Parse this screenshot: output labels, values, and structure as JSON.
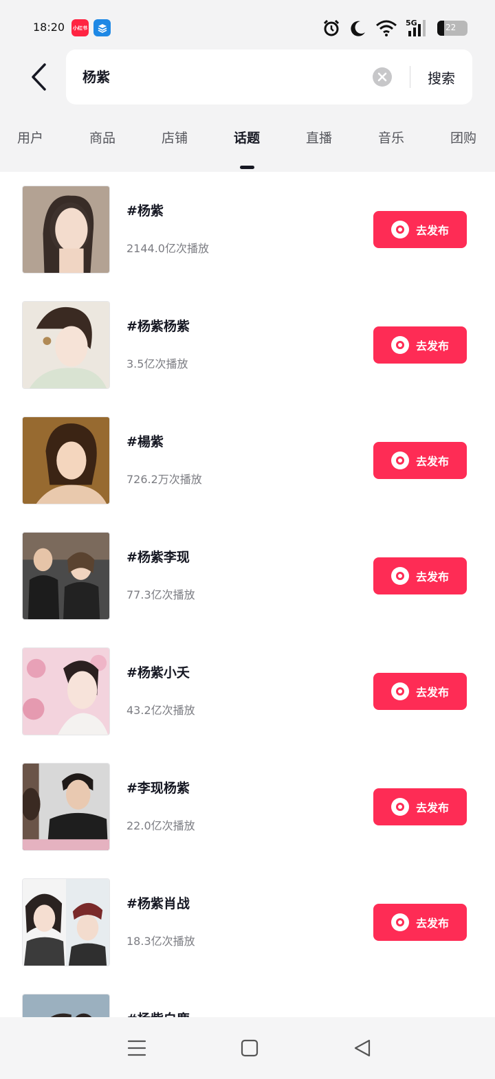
{
  "status_bar": {
    "time": "18:20",
    "apps": [
      {
        "name": "xiaohongshu",
        "label": "小红书",
        "color": "#ff2442"
      },
      {
        "name": "layers-app",
        "label": "",
        "color": "#1e88e5"
      }
    ],
    "icons": [
      "alarm-icon",
      "moon-icon",
      "wifi-icon",
      "signal-5g-icon",
      "battery-icon"
    ],
    "network": "5G",
    "battery": "22",
    "battery_level": 0.22
  },
  "search": {
    "query": "杨紫",
    "button_label": "搜索"
  },
  "tabs": [
    {
      "label": "用户",
      "active": false
    },
    {
      "label": "商品",
      "active": false
    },
    {
      "label": "店铺",
      "active": false
    },
    {
      "label": "话题",
      "active": true
    },
    {
      "label": "直播",
      "active": false
    },
    {
      "label": "音乐",
      "active": false
    },
    {
      "label": "团购",
      "active": false
    }
  ],
  "topics": [
    {
      "title": "#杨紫",
      "views": "2144.0亿次播放",
      "button": "去发布"
    },
    {
      "title": "#杨紫杨紫",
      "views": "3.5亿次播放",
      "button": "去发布"
    },
    {
      "title": "#楊紫",
      "views": "726.2万次播放",
      "button": "去发布"
    },
    {
      "title": "#杨紫李现",
      "views": "77.3亿次播放",
      "button": "去发布"
    },
    {
      "title": "#杨紫小夭",
      "views": "43.2亿次播放",
      "button": "去发布"
    },
    {
      "title": "#李现杨紫",
      "views": "22.0亿次播放",
      "button": "去发布"
    },
    {
      "title": "#杨紫肖战",
      "views": "18.3亿次播放",
      "button": "去发布"
    },
    {
      "title": "#杨紫白鹿",
      "views": "",
      "button": ""
    }
  ],
  "colors": {
    "accent": "#fe2c55",
    "top_background": "#f3f3f4",
    "text_primary": "#161823",
    "text_secondary": "#7b7c82"
  },
  "nav": [
    "menu-icon",
    "home-icon",
    "back-triangle-icon"
  ]
}
